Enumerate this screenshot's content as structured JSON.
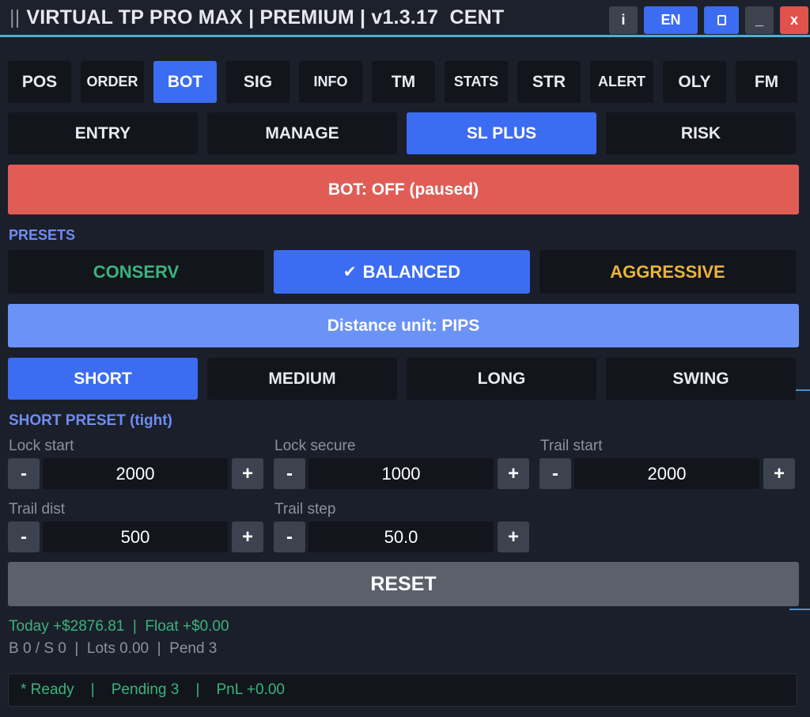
{
  "titlebar": {
    "grip": "||",
    "title": "VIRTUAL TP PRO MAX | PREMIUM | v1.3.17  CENT",
    "info_label": "i",
    "lang_label": "EN",
    "min_label": "_",
    "close_label": "x"
  },
  "main_tabs": [
    "POS",
    "ORDER",
    "BOT",
    "SIG",
    "INFO",
    "TM",
    "STATS",
    "STR",
    "ALERT",
    "OLY",
    "FM"
  ],
  "main_tab_active": "BOT",
  "sub_tabs": [
    "ENTRY",
    "MANAGE",
    "SL PLUS",
    "RISK"
  ],
  "sub_tab_active": "SL PLUS",
  "bot_status": "BOT: OFF (paused)",
  "presets": {
    "label": "PRESETS",
    "conserv": "CONSERV",
    "balanced_check": "✔",
    "balanced": "BALANCED",
    "aggressive": "AGGRESSIVE",
    "colors": {
      "conserv": "#3bb37c",
      "balanced": "#3b6cf2",
      "aggressive": "#eab43b"
    }
  },
  "distance_unit": "Distance unit: PIPS",
  "duration_tabs": [
    "SHORT",
    "MEDIUM",
    "LONG",
    "SWING"
  ],
  "duration_active": "SHORT",
  "preset_section_label": "SHORT PRESET (tight)",
  "fields": {
    "lock_start": {
      "label": "Lock start",
      "value": "2000"
    },
    "lock_secure": {
      "label": "Lock secure",
      "value": "1000"
    },
    "trail_start": {
      "label": "Trail start",
      "value": "2000"
    },
    "trail_dist": {
      "label": "Trail dist",
      "value": "500"
    },
    "trail_step": {
      "label": "Trail step",
      "value": "50.0"
    },
    "minus": "-",
    "plus": "+"
  },
  "reset_label": "RESET",
  "summary": {
    "line1": "Today +$2876.81  |  Float +$0.00",
    "line2": "B 0 / S 0  |  Lots 0.00  |  Pend 3"
  },
  "statusbar": {
    "text": "* Ready    |    Pending 3    |    PnL +0.00"
  },
  "colors": {
    "accent_blue": "#3b6cf2",
    "status_red": "#e05d56",
    "positive_green": "#3bb37c",
    "background": "#1b1f29"
  }
}
